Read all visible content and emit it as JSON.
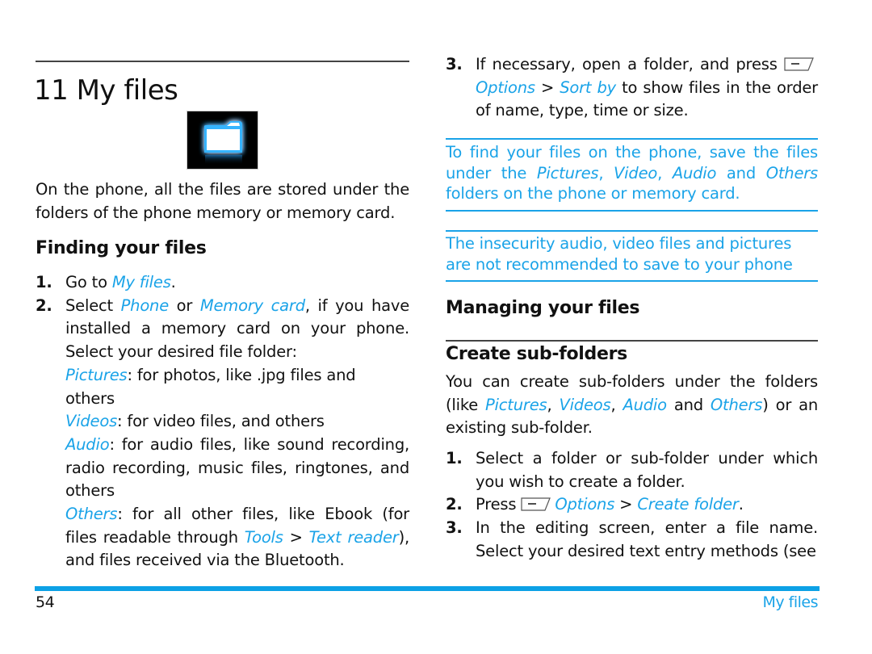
{
  "chapter": {
    "title": "11 My files",
    "icon": "folder-icon"
  },
  "left": {
    "intro": "On the phone, all the files are stored under the folders of the phone memory or memory card.",
    "finding": {
      "heading": "Finding your files",
      "step1": {
        "num": "1.",
        "pre": "Go to ",
        "link": "My files",
        "post": "."
      },
      "step2": {
        "num": "2.",
        "pre": "Select ",
        "link1": "Phone",
        "mid": " or ",
        "link2": "Memory card",
        "post": ", if you have installed a memory card on your phone. Select your desired file folder:"
      },
      "folders": [
        {
          "name": "Pictures",
          "desc": ": for photos, like .jpg files and others"
        },
        {
          "name": "Videos",
          "desc": ": for video files, and others"
        },
        {
          "name": "Audio",
          "desc": ": for audio files, like sound recording, radio recording, music files, ringtones, and others"
        },
        {
          "name": "Others",
          "desc_pre": ": for all other files, like Ebook (for files readable through ",
          "link1": "Tools",
          "sep": " > ",
          "link2": "Text reader",
          "desc_post": "), and files received via the Bluetooth."
        }
      ]
    }
  },
  "right": {
    "step3": {
      "num": "3.",
      "pre": "If necessary, open a folder, and press ",
      "softkey_icon": "left-softkey-icon",
      "link1": "Options",
      "sep": " > ",
      "link2": "Sort by",
      "post": " to show files in the order of name, type, time or size."
    },
    "note1": {
      "pre": "To find your files on the phone, save the files under the ",
      "i1": "Pictures",
      "c1": ", ",
      "i2": "Video",
      "c2": ", ",
      "i3": "Audio",
      "c3": " and ",
      "i4": "Others",
      "post": " folders on the phone or memory card."
    },
    "note2": "The insecurity audio, video files and pictures are not recommended to save to your phone",
    "managing_heading": "Managing your files",
    "create_heading": "Create sub-folders",
    "create_intro": {
      "pre": "You can create sub-folders under the folders (like ",
      "l1": "Pictures",
      "c1": ", ",
      "l2": "Videos",
      "c2": ", ",
      "l3": "Audio",
      "c3": " and ",
      "l4": "Others",
      "post": ") or an existing sub-folder."
    },
    "steps": [
      {
        "num": "1.",
        "text": "Select a folder or sub-folder under which you wish to create a folder."
      },
      {
        "num": "2.",
        "pre": "Press ",
        "link1": "Options",
        "sep": " > ",
        "link2": "Create folder",
        "post": "."
      },
      {
        "num": "3.",
        "text": "In the editing screen, enter a file name. Select your desired text entry methods (see"
      }
    ]
  },
  "footer": {
    "page_number": "54",
    "section_title": "My files"
  },
  "colors": {
    "accent": "#1aa3e8",
    "footer_bar": "#0ca1e6",
    "rule": "#444444"
  }
}
